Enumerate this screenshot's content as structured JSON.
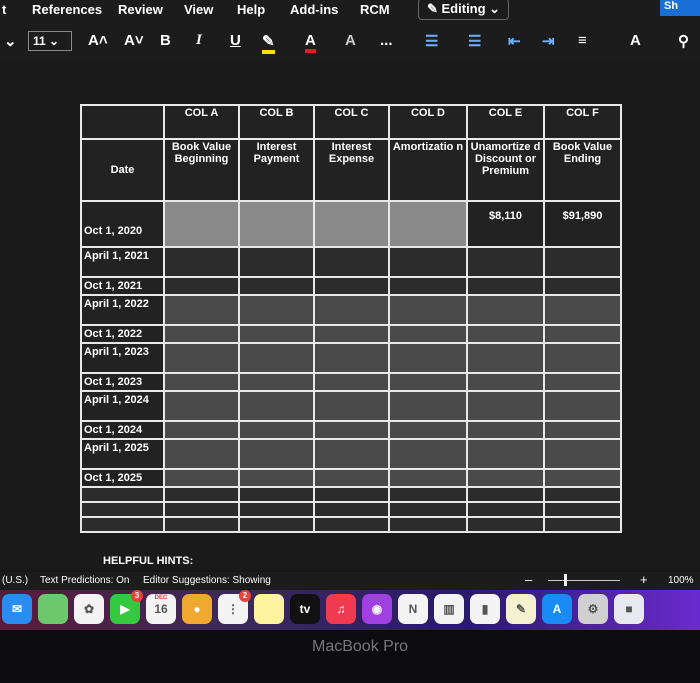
{
  "ribbon": {
    "menu": [
      "t",
      "References",
      "Review",
      "View",
      "Help",
      "Add-ins",
      "RCM"
    ],
    "editing": "Editing",
    "share": "Sh",
    "font_size": "11",
    "tools": [
      "A˄",
      "A˅",
      "B",
      "I",
      "U",
      "✎",
      "A",
      "A",
      "...",
      "☰",
      "☰",
      "⇤",
      "⇥",
      "≡",
      "A",
      "⚲"
    ],
    "highlight_color": "#f5e400",
    "font_color": "#e02020"
  },
  "table": {
    "col_labels": [
      "",
      "COL A",
      "COL B",
      "COL C",
      "COL D",
      "COL E",
      "COL F"
    ],
    "headers": [
      "Date",
      "Book Value Beginning",
      "Interest Payment",
      "Interest Expense",
      "Amortizatio n",
      "Unamortize d Discount or Premium",
      "Book Value Ending"
    ],
    "first_row": {
      "date": "Oct 1, 2020",
      "col_e": "$8,110",
      "col_f": "$91,890"
    },
    "dates": [
      "April 1, 2021",
      "Oct 1, 2021",
      "April 1, 2022",
      "Oct 1, 2022",
      "April 1, 2023",
      "Oct 1, 2023",
      "April 1, 2024",
      "Oct 1, 2024",
      "April 1, 2025",
      "Oct 1, 2025"
    ],
    "empty_rows": 3
  },
  "hints": "HELPFUL HINTS:",
  "status": {
    "language": "(U.S.)",
    "predictions": "Text Predictions: On",
    "editor": "Editor Suggestions: Showing",
    "zoom_minus": "–",
    "zoom_plus": "+",
    "zoom": "100%"
  },
  "dock": {
    "apps": [
      {
        "name": "mail",
        "color": "#2a8cf0",
        "label": "✉"
      },
      {
        "name": "maps",
        "color": "#6cc86a",
        "label": ""
      },
      {
        "name": "photos",
        "color": "#f4f4f4",
        "label": "✿"
      },
      {
        "name": "facetime",
        "color": "#35c940",
        "label": "▶",
        "badge": "3"
      },
      {
        "name": "calendar",
        "color": "#f4f4f4",
        "label": "16",
        "month": "DEC"
      },
      {
        "name": "contacts",
        "color": "#f0a830",
        "label": "●"
      },
      {
        "name": "reminders",
        "color": "#f4f4f4",
        "label": "⋮",
        "badge": "2"
      },
      {
        "name": "notes",
        "color": "#fff3a0",
        "label": ""
      },
      {
        "name": "tv",
        "color": "#111",
        "label": "tv"
      },
      {
        "name": "music",
        "color": "#f03a50",
        "label": "♫"
      },
      {
        "name": "podcasts",
        "color": "#a040e0",
        "label": "◉"
      },
      {
        "name": "news",
        "color": "#f4f4f4",
        "label": "N"
      },
      {
        "name": "keynote",
        "color": "#f4f4f4",
        "label": "▥"
      },
      {
        "name": "numbers",
        "color": "#f4f4f4",
        "label": "▮"
      },
      {
        "name": "pages",
        "color": "#f4f0d0",
        "label": "✎"
      },
      {
        "name": "app-store",
        "color": "#1a8af5",
        "label": "A"
      },
      {
        "name": "system-settings",
        "color": "#d0d0d0",
        "label": "⚙"
      },
      {
        "name": "roblox",
        "color": "#e8e8f0",
        "label": "■"
      }
    ]
  },
  "device": "MacBook Pro"
}
